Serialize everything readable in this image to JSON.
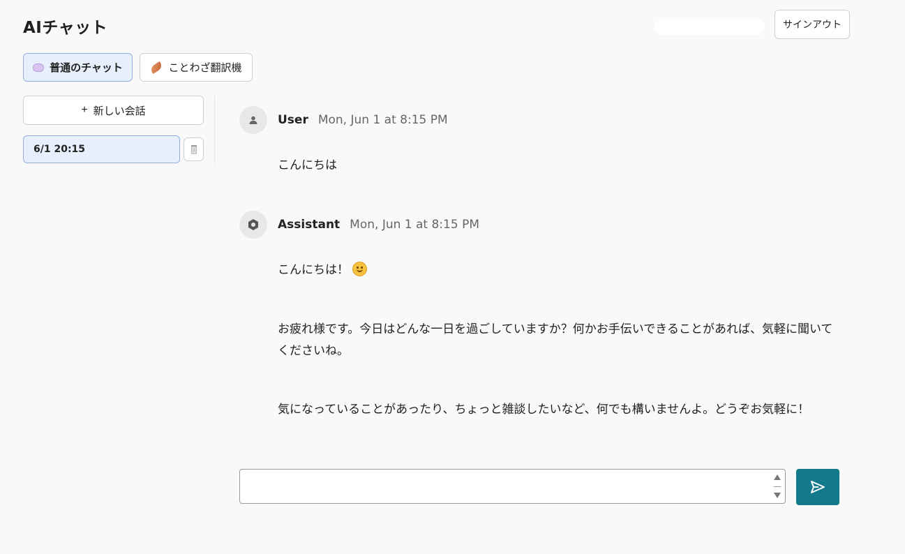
{
  "header": {
    "app_title": "AIチャット",
    "signout_label": "サインアウト"
  },
  "mode_tabs": [
    {
      "label": "普通のチャット",
      "icon": "speech-bubble-icon",
      "active": true
    },
    {
      "label": "ことわざ翻訳機",
      "icon": "feather-icon",
      "active": false
    }
  ],
  "sidebar": {
    "new_chat_label": "新しい会話",
    "conversations": [
      {
        "label": "6/1 20:15",
        "selected": true
      }
    ]
  },
  "messages": [
    {
      "author": "User",
      "time": "Mon, Jun 1 at 8:15 PM",
      "paragraphs": [
        "こんにちは"
      ]
    },
    {
      "author": "Assistant",
      "time": "Mon, Jun 1 at 8:15 PM",
      "paragraphs": [
        "こんにちは！",
        "お疲れ様です。今日はどんな一日を過ごしていますか？何かお手伝いできることがあれば、気軽に聞いてくださいね。",
        "気になっていることがあったり、ちょっと雑談したいなど、何でも構いませんよ。どうぞお気軽に！"
      ]
    }
  ],
  "composer": {
    "value": "",
    "placeholder": ""
  },
  "colors": {
    "accent": "#127a8c",
    "active_tab_bg": "#e7effc",
    "active_tab_border": "#8fb0e0",
    "background": "#f9f9f9"
  }
}
